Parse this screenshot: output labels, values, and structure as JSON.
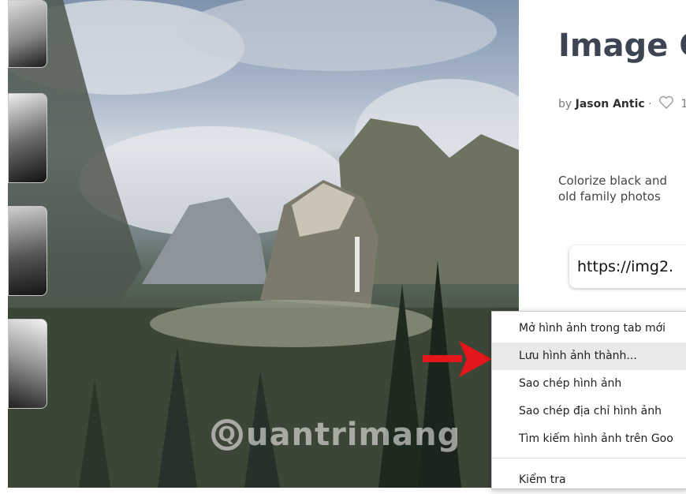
{
  "page": {
    "title": "Image C",
    "byline_prefix": "by",
    "author": "Jason Antic",
    "byline_separator": "·",
    "heart_count": "1",
    "description_lines": [
      "Colorize black and",
      "old family photos"
    ],
    "url_text": "https://img2."
  },
  "watermark": {
    "letter": "Q",
    "text": "uantrimang"
  },
  "context_menu": {
    "items": [
      "Mở hình ảnh trong tab mới",
      "Lưu hình ảnh thành...",
      "Sao chép hình ảnh",
      "Sao chép địa chỉ hình ảnh",
      "Tìm kiếm hình ảnh trên Goo",
      "Kiểm tra"
    ],
    "highlighted_index": 1
  },
  "colors": {
    "arrow": "#e3171b",
    "title": "#3d4553",
    "menu_highlight": "#e9e9e9"
  },
  "icons": [
    "heart-icon",
    "red-arrow-icon"
  ]
}
